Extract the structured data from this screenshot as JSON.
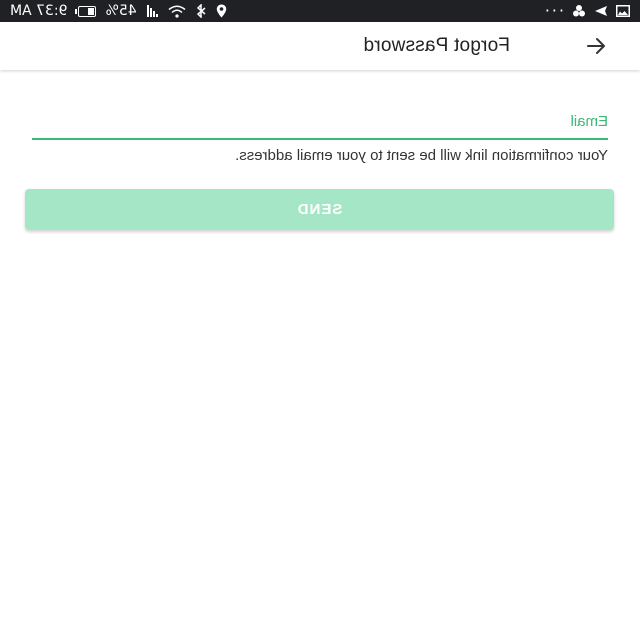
{
  "status_bar": {
    "time": "9:37 AM",
    "battery_percent": "45%",
    "battery_level": 0.45,
    "more_dots": "···",
    "icons_left": [
      "image-icon",
      "send-icon",
      "pinwheel-icon"
    ],
    "icons_right": [
      "location-icon",
      "bluetooth-icon",
      "wifi-icon",
      "signal-icon",
      "battery-icon"
    ]
  },
  "app_bar": {
    "title": "Forgot Password",
    "back_icon": "arrow-back-icon"
  },
  "form": {
    "email_placeholder": "Email",
    "email_value": "",
    "helper_text": "Your confirmation link will be sent to your email address.",
    "send_label": "SEND"
  },
  "colors": {
    "accent": "#3cb878",
    "button_disabled": "#a5e6c6",
    "status_bar": "#202124"
  }
}
